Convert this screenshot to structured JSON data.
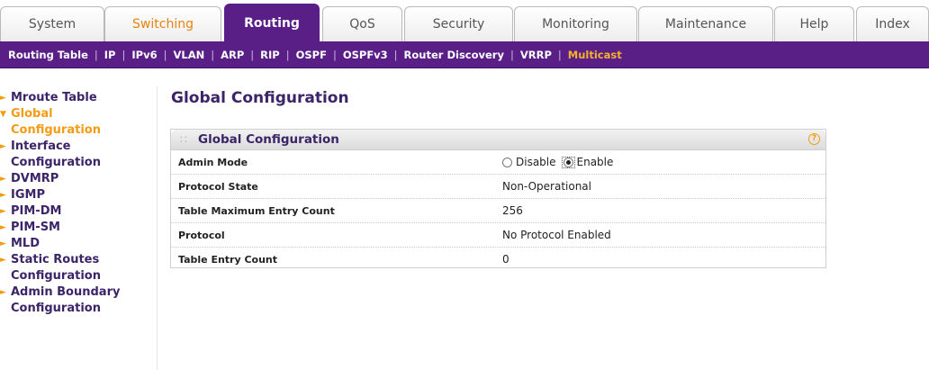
{
  "top_tabs": [
    {
      "label": "System"
    },
    {
      "label": "Switching"
    },
    {
      "label": "Routing"
    },
    {
      "label": "QoS"
    },
    {
      "label": "Security"
    },
    {
      "label": "Monitoring"
    },
    {
      "label": "Maintenance"
    },
    {
      "label": "Help"
    },
    {
      "label": "Index"
    }
  ],
  "subnav": [
    {
      "label": "Routing Table"
    },
    {
      "label": "IP"
    },
    {
      "label": "IPv6"
    },
    {
      "label": "VLAN"
    },
    {
      "label": "ARP"
    },
    {
      "label": "RIP"
    },
    {
      "label": "OSPF"
    },
    {
      "label": "OSPFv3"
    },
    {
      "label": "Router Discovery"
    },
    {
      "label": "VRRP"
    },
    {
      "label": "Multicast"
    }
  ],
  "sidebar": {
    "items": [
      {
        "label": "Mroute Table"
      },
      {
        "label": "Global Configuration"
      },
      {
        "label": "Interface Configuration"
      },
      {
        "label": "DVMRP"
      },
      {
        "label": "IGMP"
      },
      {
        "label": "PIM-DM"
      },
      {
        "label": "PIM-SM"
      },
      {
        "label": "MLD"
      },
      {
        "label": "Static Routes Configuration"
      },
      {
        "label": "Admin Boundary Configuration"
      }
    ]
  },
  "page": {
    "title": "Global Configuration",
    "panel_title": "Global Configuration",
    "help_symbol": "?"
  },
  "form": {
    "admin_mode": {
      "label": "Admin Mode",
      "option_disable": "Disable",
      "option_enable": "Enable",
      "selected": "Enable"
    },
    "protocol_state": {
      "label": "Protocol State",
      "value": "Non-Operational"
    },
    "table_max_entry_count": {
      "label": "Table Maximum Entry Count",
      "value": "256"
    },
    "protocol": {
      "label": "Protocol",
      "value": "No Protocol Enabled"
    },
    "table_entry_count": {
      "label": "Table Entry Count",
      "value": "0"
    }
  },
  "colors": {
    "brand_purple": "#5a1f87",
    "accent_orange": "#f39c12",
    "text_dark_purple": "#3b2468"
  }
}
